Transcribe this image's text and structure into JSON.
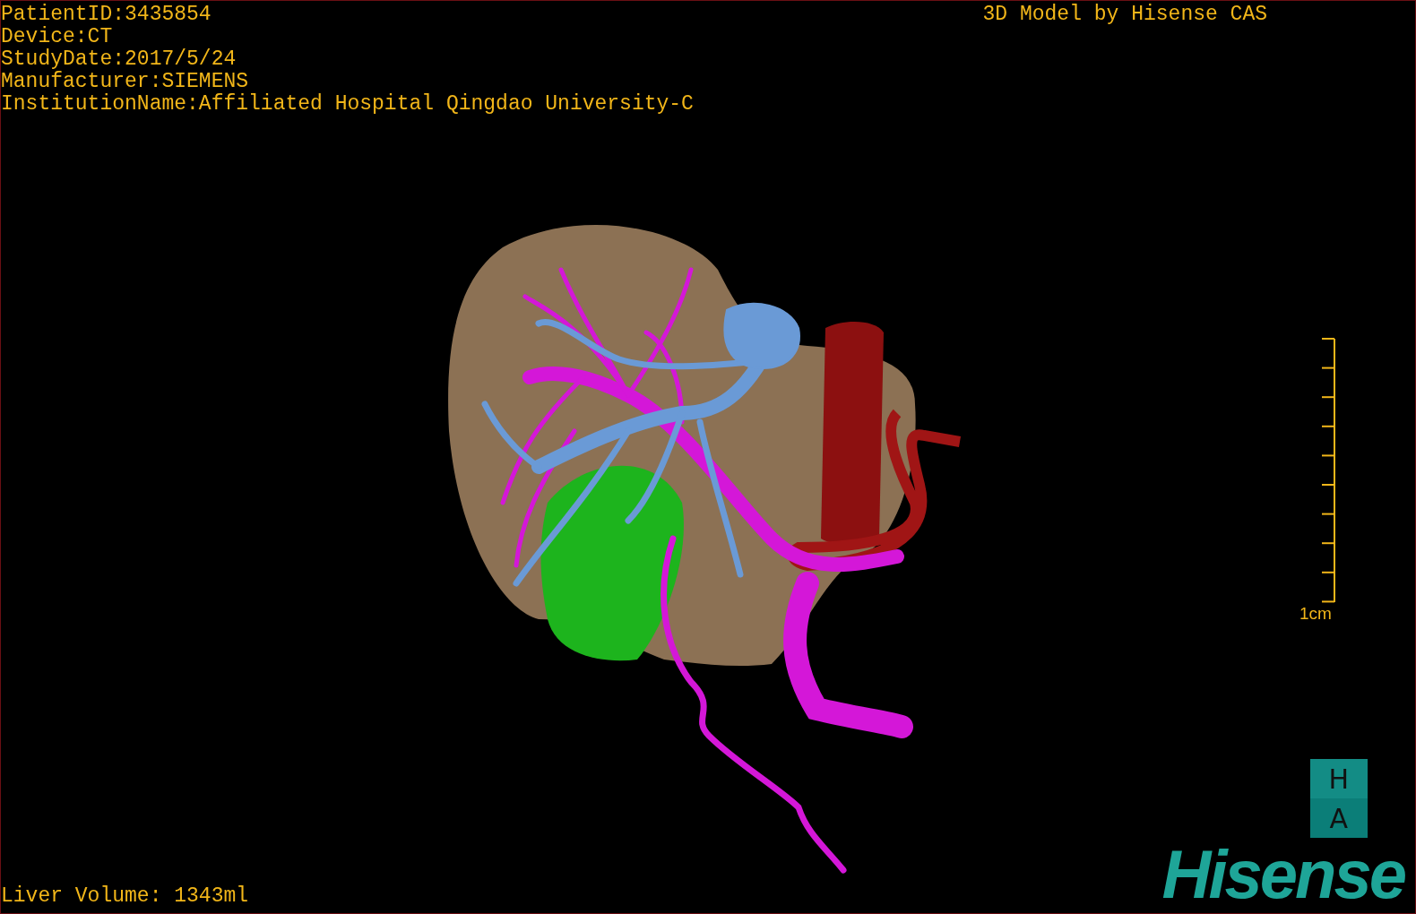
{
  "patient_info": [
    "PatientID:3435854",
    "Device:CT",
    "StudyDate:2017/5/24",
    "Manufacturer:SIEMENS",
    "InstitutionName:Affiliated Hospital Qingdao University-C"
  ],
  "model_title": "3D Model by Hisense CAS",
  "scale_bar": {
    "label": "1cm"
  },
  "liver_volume": "Liver Volume: 1343ml",
  "logo": {
    "badge": [
      "H",
      "A"
    ],
    "wordmark": "Hisense"
  }
}
